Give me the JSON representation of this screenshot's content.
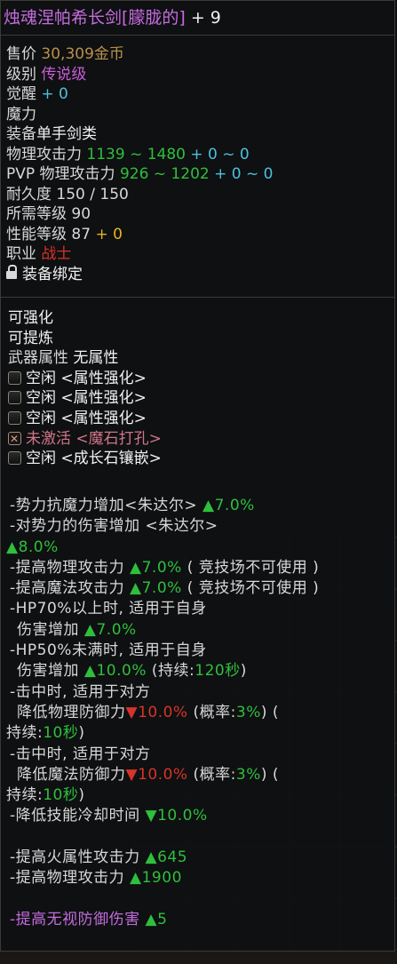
{
  "item": {
    "name": "烛魂涅帕希长剑[朦胧的]",
    "enhance": "+ 9"
  },
  "basic": {
    "price_label": "售价",
    "price_value": "30,309金币",
    "grade_label": "级别",
    "grade_value": "传说级",
    "awaken_label": "觉醒",
    "awaken_value": "+ 0",
    "magic_label": "魔力",
    "equip_label": "装备",
    "equip_value": "单手剑类",
    "patk_label": "物理攻击力",
    "patk_range": "1139 ~ 1480",
    "patk_bonus": "+ 0 ~ 0",
    "pvp_label": "PVP 物理攻击力",
    "pvp_range": "926 ~ 1202",
    "pvp_bonus": "+ 0 ~ 0",
    "dur_label": "耐久度",
    "dur_value": "150 / 150",
    "lvl_label": "所需等级",
    "lvl_value": "90",
    "perf_label": "性能等级",
    "perf_value": "87",
    "perf_bonus": "+ 0",
    "job_label": "职业",
    "job_value": "战士",
    "bind_text": "装备绑定"
  },
  "upgrade": {
    "line1": "可强化",
    "line2": "可提炼",
    "attr_label": "武器属性",
    "attr_value": "无属性",
    "sockets": [
      {
        "text": "空闲 <属性强化>",
        "state": "empty"
      },
      {
        "text": "空闲 <属性强化>",
        "state": "empty"
      },
      {
        "text": "空闲 <属性强化>",
        "state": "empty"
      },
      {
        "text": "未激活 <魔石打孔>",
        "state": "inactive"
      },
      {
        "text": "空闲 <成长石镶嵌>",
        "state": "empty"
      }
    ]
  },
  "options": {
    "o1a": "-势力抗魔力增加<朱达尔>",
    "o1b": "▲7.0%",
    "o2a": "-对势力的伤害增加 <朱达尔>",
    "o2b": "▲8.0%",
    "o3a": "-提高物理攻击力",
    "o3b": "▲7.0%",
    "o3c": "( 竞技场不可使用 )",
    "o4a": "-提高魔法攻击力",
    "o4b": "▲7.0%",
    "o4c": "( 竞技场不可使用 )",
    "o5a": "-HP70%以上时, 适用于自身",
    "o5b": "伤害增加",
    "o5c": "▲7.0%",
    "o6a": "-HP50%未满时, 适用于自身",
    "o6b": "伤害增加",
    "o6c": "▲10.0%",
    "o6d": "(持续:",
    "o6e": "120秒",
    "o6f": ")",
    "o7a": "-击中时, 适用于对方",
    "o7b": "降低物理防御力",
    "o7c": "▼10.0%",
    "o7d": "(概率:",
    "o7e": "3%",
    "o7f": ") (",
    "o7g": "持续:",
    "o7h": "10秒",
    "o7i": ")",
    "o8a": "-击中时, 适用于对方",
    "o8b": "降低魔法防御力",
    "o8c": "▼10.0%",
    "o8d": "(概率:",
    "o8e": "3%",
    "o8f": ") (",
    "o8g": "持续:",
    "o8h": "10秒",
    "o8i": ")",
    "o9a": "-降低技能冷却时间",
    "o9b": "▼10.0%",
    "o10a": "-提高火属性攻击力",
    "o10b": "▲645",
    "o11a": "-提高物理攻击力",
    "o11b": "▲1900",
    "o12a": "-提高无视防御伤害",
    "o12b": "▲5"
  }
}
